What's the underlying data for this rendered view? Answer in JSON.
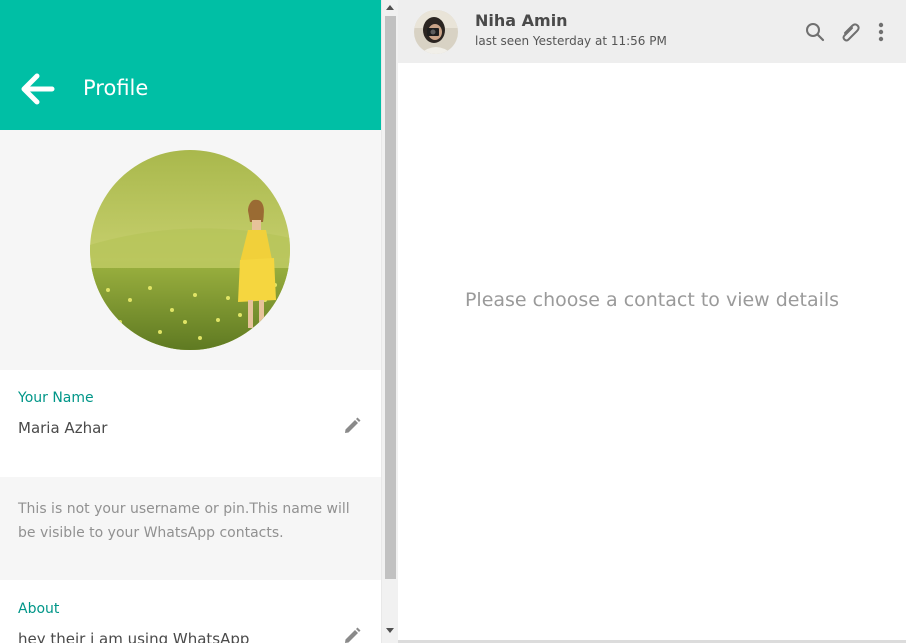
{
  "profile": {
    "title": "Profile",
    "name_label": "Your Name",
    "name_value": "Maria Azhar",
    "hint": "This is not your username or pin.This name will be visible to your WhatsApp contacts.",
    "about_label": "About",
    "about_value": "hey their i am using WhatsApp"
  },
  "chat": {
    "contact_name": "Niha Amin",
    "contact_status": "last seen Yesterday at 11:56 PM",
    "empty_message": "Please choose a contact to view details"
  },
  "icons": {
    "back": "arrow-left-icon",
    "edit": "pencil-icon",
    "search": "search-icon",
    "attach": "paperclip-icon",
    "menu": "more-vertical-icon"
  },
  "colors": {
    "accent": "#00bfa5",
    "label": "#009688",
    "panel_bg": "#f6f6f6",
    "header_bg": "#eeeeee"
  }
}
